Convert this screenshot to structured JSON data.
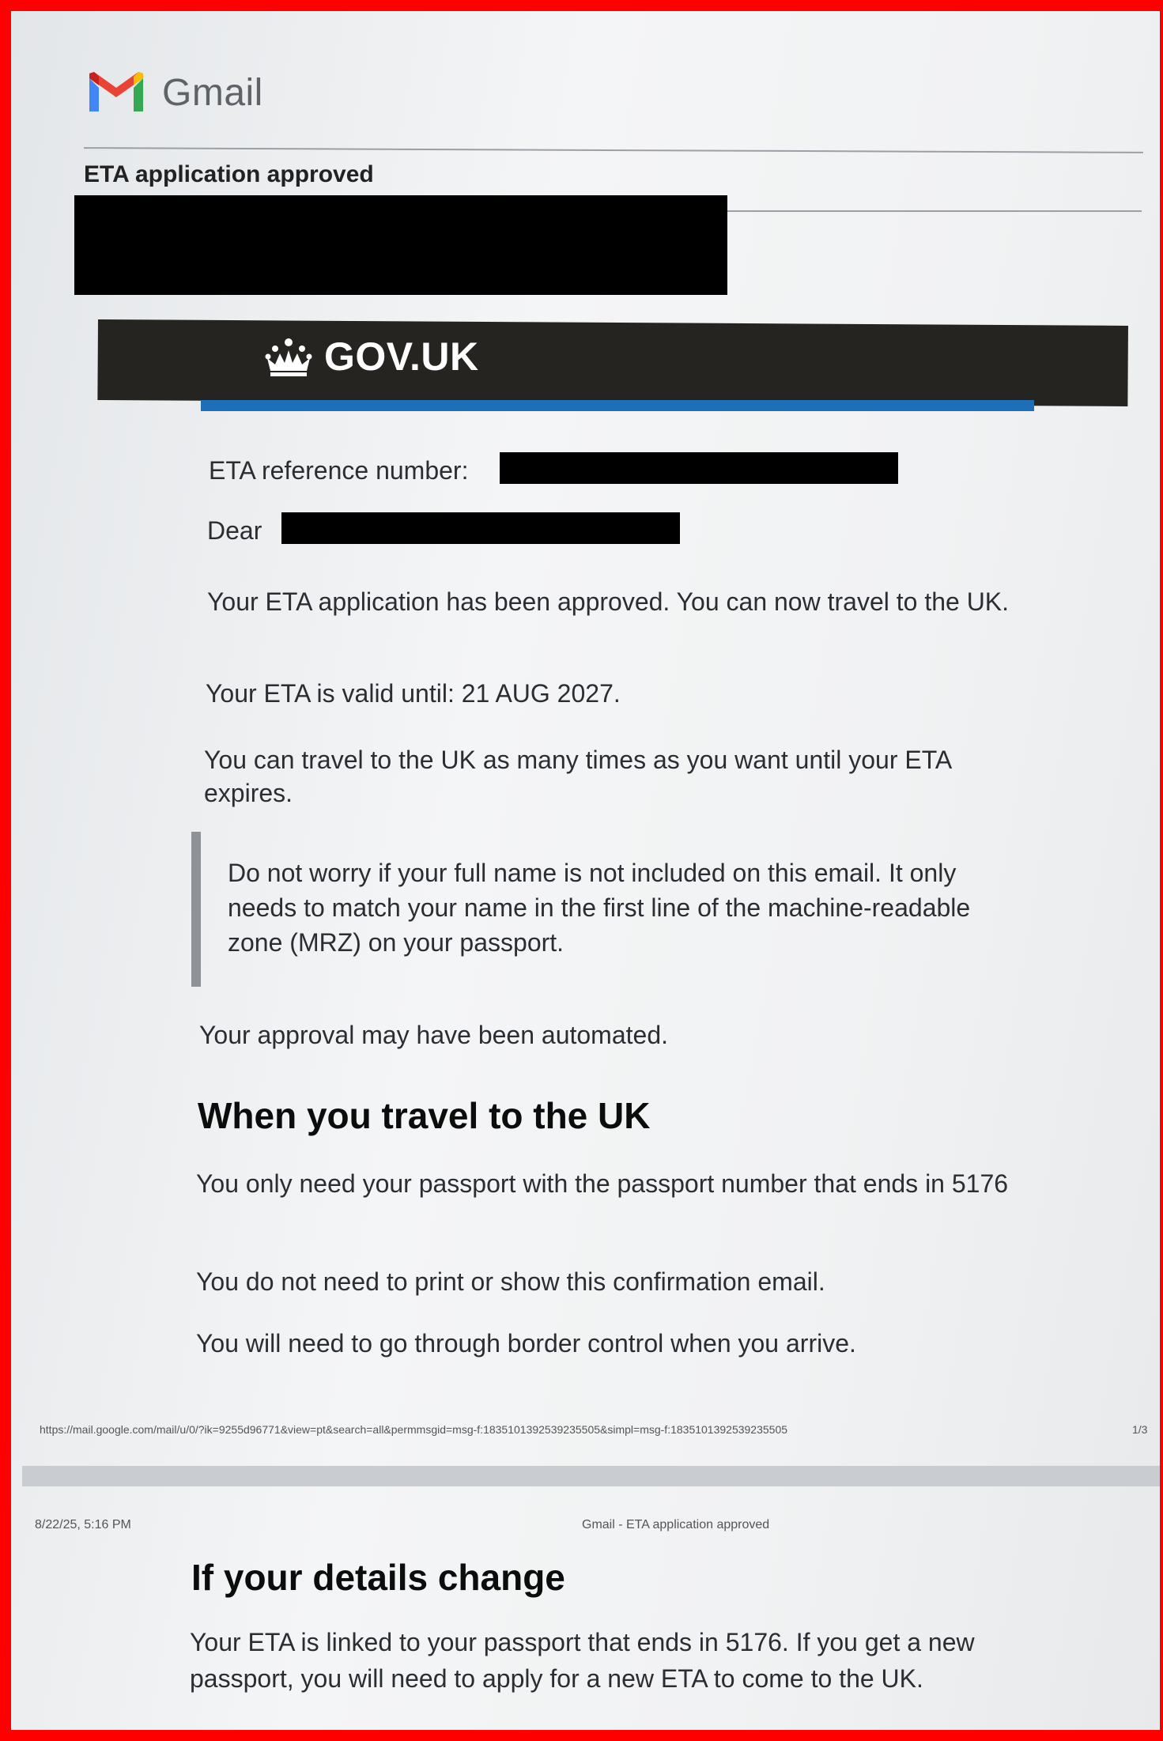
{
  "gmail": {
    "logo_text": "Gmail",
    "subject": "ETA application approved"
  },
  "gov": {
    "brand": "GOV.UK"
  },
  "email": {
    "ref_label": "ETA reference number:",
    "dear_label": "Dear",
    "approved": "Your ETA application has been approved. You can now travel to the UK.",
    "valid": "Your ETA is valid until: 21 AUG 2027.",
    "times": "You can travel to the UK as many times as you want until your ETA expires.",
    "inset": "Do not worry if your full name is not included on this email. It only needs to match your name in the first line of the machine-readable zone (MRZ) on your passport.",
    "automated": "Your approval may have been automated.",
    "travel_heading": "When you travel to the UK",
    "passport_only": "You only need your passport with the passport number that ends in 5176",
    "no_print": "You do not need to print or show this confirmation email.",
    "border": "You will need to go through border control when you arrive.",
    "details_heading": "If your details change",
    "linked": "Your ETA is linked to your passport that ends in 5176. If you get a new passport, you will need to apply for a new ETA to come to the UK."
  },
  "print_footer": {
    "url": "https://mail.google.com/mail/u/0/?ik=9255d96771&view=pt&search=all&permmsgid=msg-f:1835101392539235505&simpl=msg-f:1835101392539235505",
    "page": "1/3"
  },
  "print_header": {
    "date": "8/22/25, 5:16 PM",
    "title": "Gmail - ETA application approved"
  },
  "colors": {
    "gov_header": "#262421",
    "gov_bar": "#1d70b8",
    "frame": "#ff0000"
  }
}
